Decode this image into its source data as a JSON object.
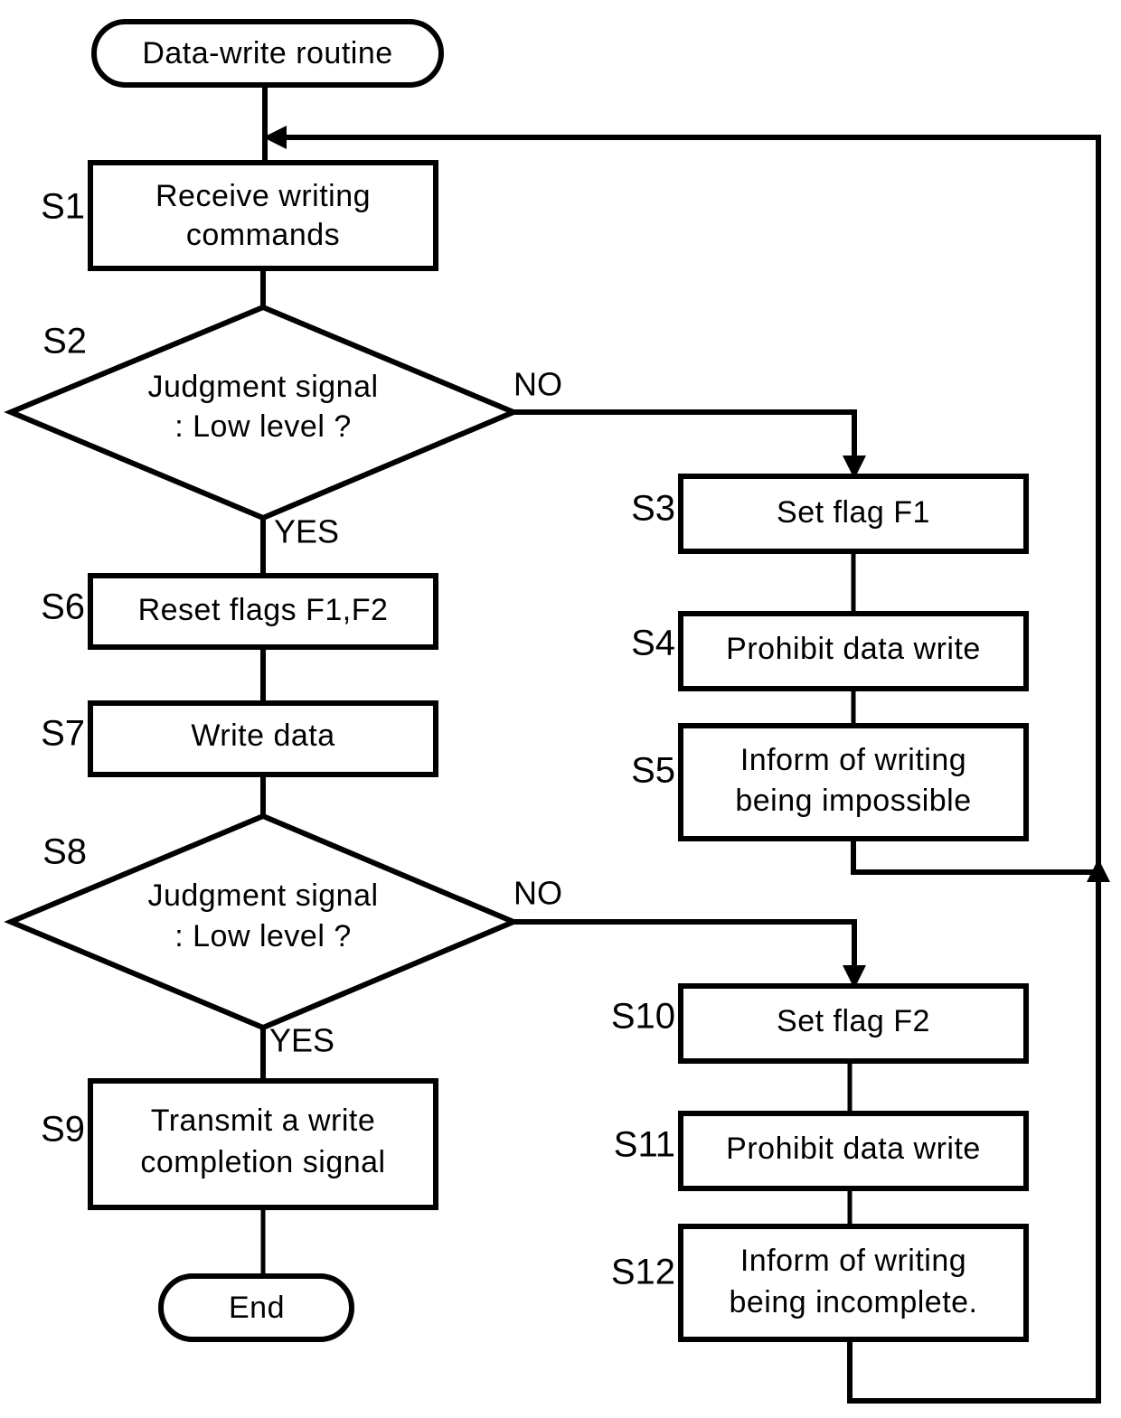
{
  "diagram": {
    "title": "Data-write routine",
    "type": "flowchart",
    "terminals": {
      "start": "Data-write routine",
      "end": "End"
    },
    "branch_labels": {
      "yes": "YES",
      "no": "NO"
    },
    "nodes": [
      {
        "id": "start",
        "step": "",
        "shape": "terminator",
        "lines": [
          "Data-write routine"
        ]
      },
      {
        "id": "s1",
        "step": "S1",
        "shape": "process",
        "lines": [
          "Receive  writing",
          "commands"
        ]
      },
      {
        "id": "s2",
        "step": "S2",
        "shape": "decision",
        "lines": [
          "Judgment  signal",
          ": Low  level ?"
        ]
      },
      {
        "id": "s3",
        "step": "S3",
        "shape": "process",
        "lines": [
          "Set  flag   F1"
        ]
      },
      {
        "id": "s4",
        "step": "S4",
        "shape": "process",
        "lines": [
          "Prohibit  data  write"
        ]
      },
      {
        "id": "s5",
        "step": "S5",
        "shape": "process",
        "lines": [
          "Inform  of  writing",
          "being  impossible"
        ]
      },
      {
        "id": "s6",
        "step": "S6",
        "shape": "process",
        "lines": [
          "Reset  flags  F1,F2"
        ]
      },
      {
        "id": "s7",
        "step": "S7",
        "shape": "process",
        "lines": [
          "Write  data"
        ]
      },
      {
        "id": "s8",
        "step": "S8",
        "shape": "decision",
        "lines": [
          "Judgment  signal",
          ": Low  level ?"
        ]
      },
      {
        "id": "s9",
        "step": "S9",
        "shape": "process",
        "lines": [
          "Transmit  a  write",
          "completion  signal"
        ]
      },
      {
        "id": "s10",
        "step": "S10",
        "shape": "process",
        "lines": [
          "Set  flag   F2"
        ]
      },
      {
        "id": "s11",
        "step": "S11",
        "shape": "process",
        "lines": [
          "Prohibit  data  write"
        ]
      },
      {
        "id": "s12",
        "step": "S12",
        "shape": "process",
        "lines": [
          "Inform  of  writing",
          "being  incomplete."
        ]
      },
      {
        "id": "end",
        "step": "",
        "shape": "terminator",
        "lines": [
          "End"
        ]
      }
    ],
    "edges": [
      {
        "from": "start",
        "to": "s1",
        "label": ""
      },
      {
        "from": "s1",
        "to": "s2",
        "label": ""
      },
      {
        "from": "s2",
        "to": "s6",
        "label": "YES"
      },
      {
        "from": "s2",
        "to": "s3",
        "label": "NO"
      },
      {
        "from": "s3",
        "to": "s4",
        "label": ""
      },
      {
        "from": "s4",
        "to": "s5",
        "label": ""
      },
      {
        "from": "s5",
        "to": "s1",
        "label": ""
      },
      {
        "from": "s6",
        "to": "s7",
        "label": ""
      },
      {
        "from": "s7",
        "to": "s8",
        "label": ""
      },
      {
        "from": "s8",
        "to": "s9",
        "label": "YES"
      },
      {
        "from": "s8",
        "to": "s10",
        "label": "NO"
      },
      {
        "from": "s9",
        "to": "end",
        "label": ""
      },
      {
        "from": "s10",
        "to": "s11",
        "label": ""
      },
      {
        "from": "s11",
        "to": "s12",
        "label": ""
      },
      {
        "from": "s12",
        "to": "s1",
        "label": ""
      }
    ],
    "colors": {
      "stroke": "#000000",
      "fill": "#ffffff",
      "text": "#000000"
    }
  }
}
